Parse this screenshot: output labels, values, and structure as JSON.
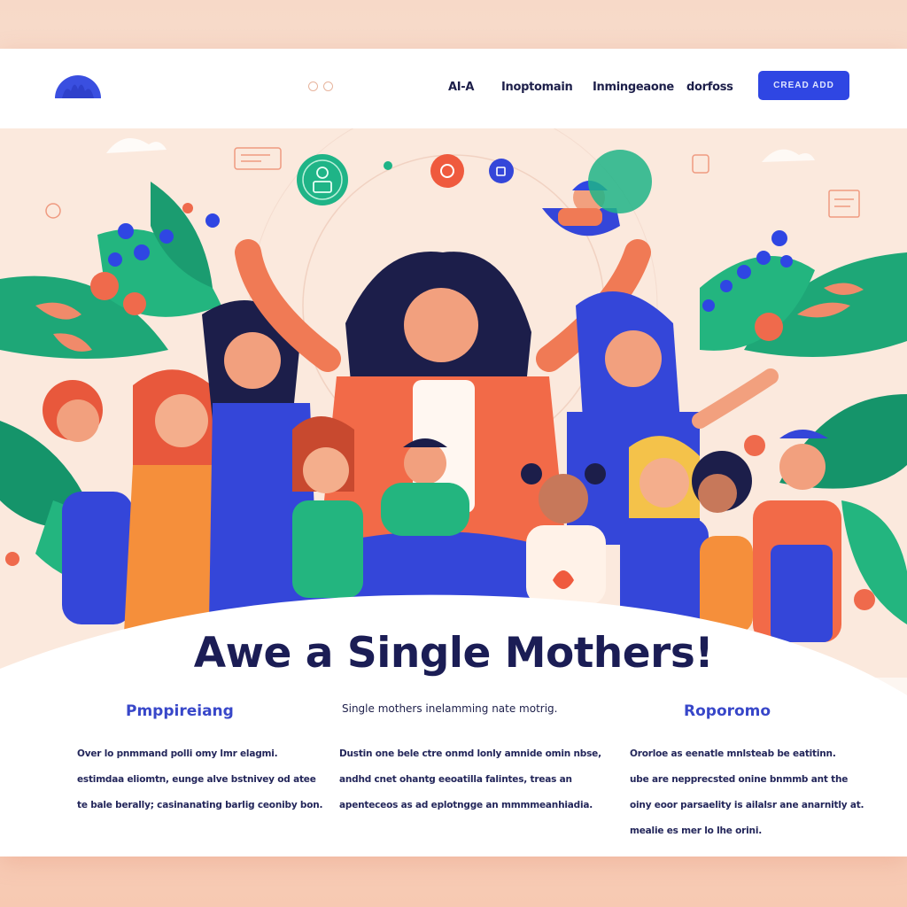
{
  "nav": {
    "links": [
      "AI-A",
      "Inoptomain",
      "Inmingeaone",
      "dorfoss"
    ],
    "cta_label": "CREAD ADD"
  },
  "hero": {
    "headline": "Awe a Single Mothers!"
  },
  "columns": [
    {
      "title": "Pmppireiang",
      "lines": [
        "Over lo pnmmand polli omy lmr elagmi.",
        "estimdaa eliomtn, eunge alve bstnivey od atee",
        "te bale berally; casinanating barlig ceoniby bon."
      ]
    },
    {
      "subtitle": "Single mothers inelamming nate motrig.",
      "lines": [
        "Dustin one bele ctre onmd lonly amnide omin nbse,",
        "andhd cnet ohantg eeoatilla falintes, treas an",
        "apenteceos as ad eplotngge an mmmmeanhiadia."
      ]
    },
    {
      "title": "Roporomo",
      "lines": [
        "Ororloe as eenatle mnlsteab be eatitinn.",
        "ube are nepprecsted onine bnmmb ant the",
        "oiny eoor parsaelity is ailalsr ane anarnitly at.",
        "mealie es mer lo lhe orini."
      ]
    }
  ],
  "colors": {
    "brand_blue": "#2f46e3",
    "heading_navy": "#1b1d55",
    "accent_coral": "#ef6a4c",
    "accent_green": "#23b57f"
  }
}
